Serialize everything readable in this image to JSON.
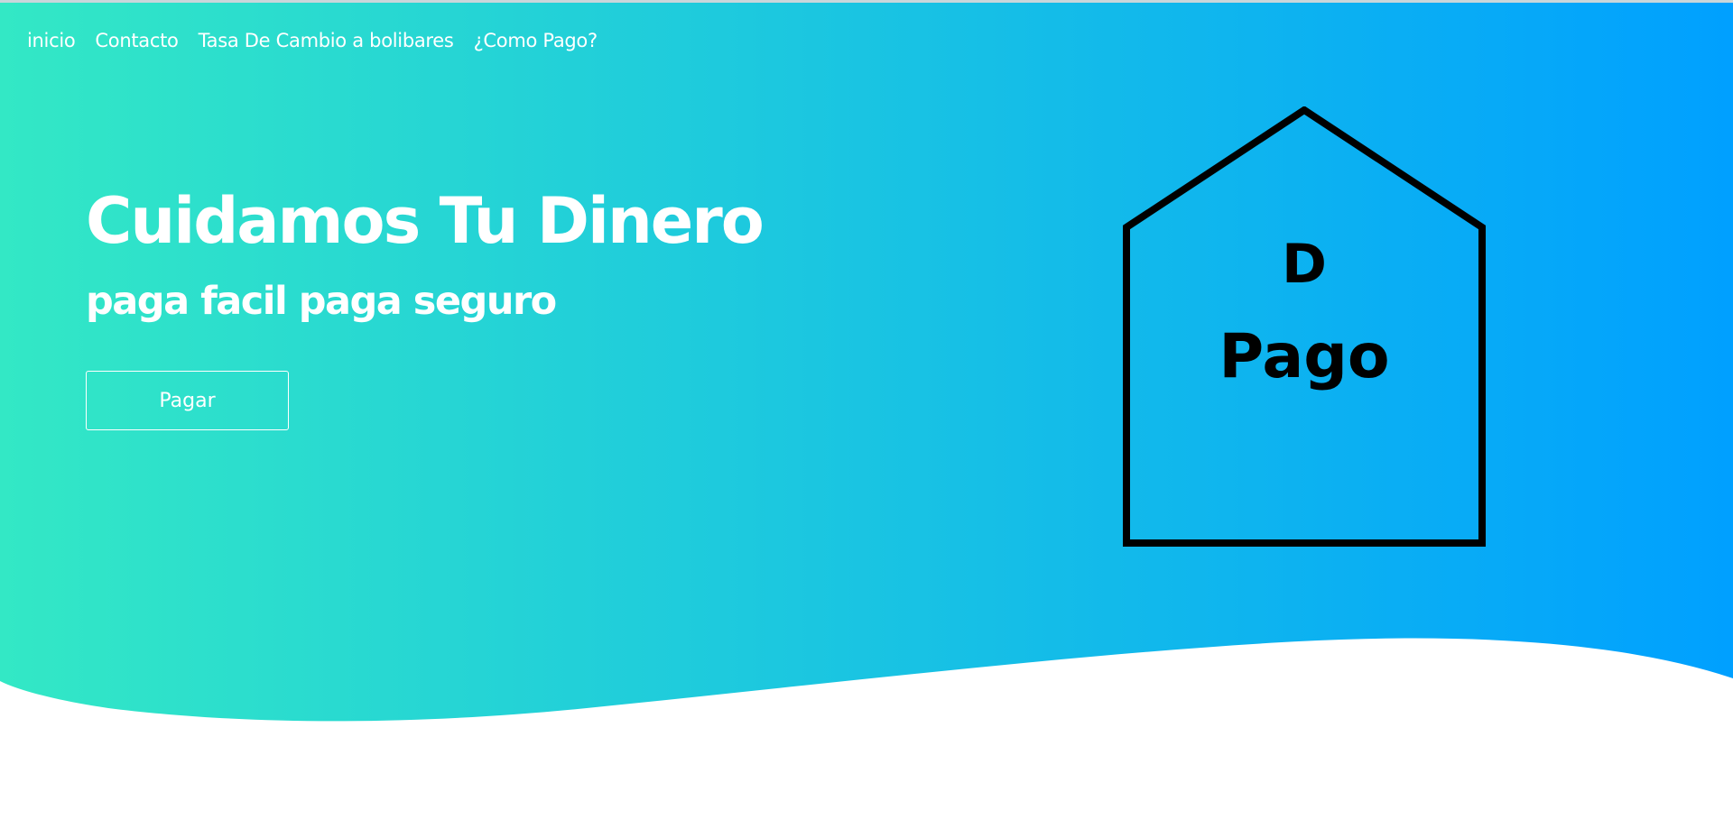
{
  "nav": {
    "items": [
      {
        "label": "inicio"
      },
      {
        "label": "Contacto"
      },
      {
        "label": "Tasa De Cambio a bolibares"
      },
      {
        "label": "¿Como Pago?"
      }
    ]
  },
  "hero": {
    "title": "Cuidamos Tu Dinero",
    "subtitle": "paga facil paga seguro",
    "cta_label": "Pagar"
  },
  "logo": {
    "letter": "D",
    "word": "Pago"
  },
  "colors": {
    "gradient_start": "#33e8c5",
    "gradient_end": "#00a0ff",
    "text": "#ffffff",
    "logo_stroke": "#000000"
  }
}
